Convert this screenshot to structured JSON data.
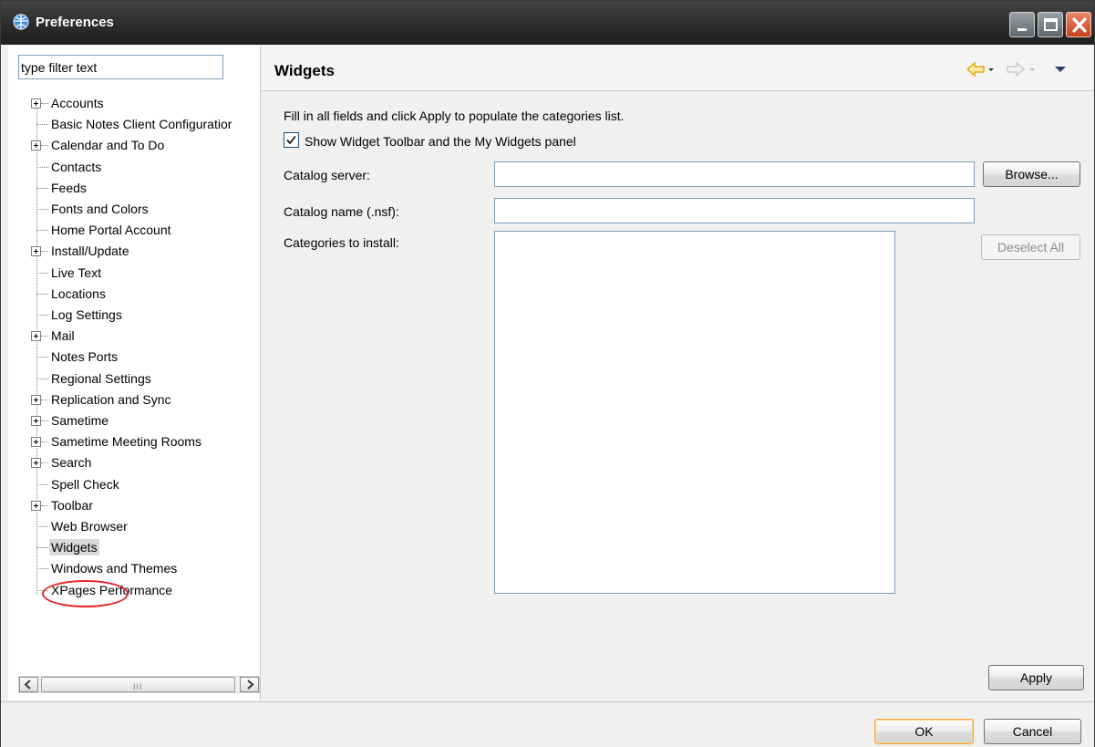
{
  "window": {
    "title": "Preferences",
    "icon": "globe-icon",
    "controls": [
      "minimize-icon",
      "maximize-icon",
      "close-icon"
    ]
  },
  "filter": {
    "value": "type filter text"
  },
  "tree": {
    "items": [
      {
        "label": "Accounts",
        "expandable": true
      },
      {
        "label": "Basic Notes Client Configuratior",
        "expandable": false
      },
      {
        "label": "Calendar and To Do",
        "expandable": true
      },
      {
        "label": "Contacts",
        "expandable": false
      },
      {
        "label": "Feeds",
        "expandable": false
      },
      {
        "label": "Fonts and Colors",
        "expandable": false
      },
      {
        "label": "Home Portal Account",
        "expandable": false
      },
      {
        "label": "Install/Update",
        "expandable": true
      },
      {
        "label": "Live Text",
        "expandable": false
      },
      {
        "label": "Locations",
        "expandable": false
      },
      {
        "label": "Log Settings",
        "expandable": false
      },
      {
        "label": "Mail",
        "expandable": true
      },
      {
        "label": "Notes Ports",
        "expandable": false
      },
      {
        "label": "Regional Settings",
        "expandable": false
      },
      {
        "label": "Replication and Sync",
        "expandable": true
      },
      {
        "label": "Sametime",
        "expandable": true
      },
      {
        "label": "Sametime Meeting Rooms",
        "expandable": true
      },
      {
        "label": "Search",
        "expandable": true
      },
      {
        "label": "Spell Check",
        "expandable": false
      },
      {
        "label": "Toolbar",
        "expandable": true
      },
      {
        "label": "Web Browser",
        "expandable": false
      },
      {
        "label": "Widgets",
        "expandable": false,
        "selected": true
      },
      {
        "label": "Windows and Themes",
        "expandable": false
      },
      {
        "label": "XPages Performance",
        "expandable": false
      }
    ],
    "scroll_grip": "III"
  },
  "page": {
    "title": "Widgets",
    "description": "Fill in all fields and click Apply to populate the categories list.",
    "checkbox_label": "Show Widget Toolbar and the My Widgets panel",
    "checkbox_checked": true,
    "catalog_server_label": "Catalog server:",
    "catalog_server_value": "",
    "catalog_name_label": "Catalog name (.nsf):",
    "catalog_name_value": "",
    "categories_label": "Categories to install:",
    "browse_label": "Browse...",
    "deselect_all_label": "Deselect All",
    "apply_label": "Apply"
  },
  "nav": {
    "icons": [
      "back-arrow-icon",
      "dropdown-icon",
      "forward-arrow-icon",
      "dropdown-icon",
      "view-menu-icon"
    ],
    "accent_color": "#f2b705"
  },
  "footer": {
    "ok_label": "OK",
    "cancel_label": "Cancel"
  }
}
